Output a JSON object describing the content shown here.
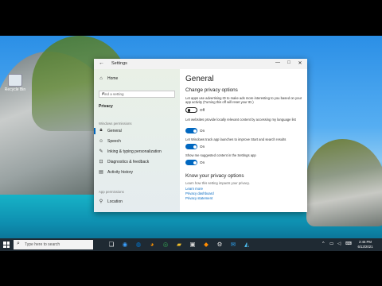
{
  "desktop": {
    "icon_label": "Recycle Bin"
  },
  "window": {
    "title": "Settings",
    "back_glyph": "←",
    "controls": {
      "minimize": "—",
      "maximize": "□",
      "close": "✕"
    }
  },
  "nav": {
    "home": "Home",
    "search_placeholder": "Find a setting",
    "privacy_header": "Privacy",
    "windows_permissions": "Windows permissions",
    "items": [
      {
        "label": "General",
        "icon": "lock-icon"
      },
      {
        "label": "Speech",
        "icon": "speech-icon"
      },
      {
        "label": "Inking & typing personalization",
        "icon": "inking-icon"
      },
      {
        "label": "Diagnostics & feedback",
        "icon": "diagnostics-icon"
      },
      {
        "label": "Activity history",
        "icon": "activity-icon"
      }
    ],
    "app_permissions": "App permissions",
    "location": "Location"
  },
  "content": {
    "title": "General",
    "section_title": "Change privacy options",
    "options": [
      {
        "desc": "Let apps use advertising ID to make ads more interesting to you based on your app activity (Turning this off will reset your ID.)",
        "state": "Off",
        "on": false
      },
      {
        "desc": "Let websites provide locally relevant content by accessing my language list",
        "state": "On",
        "on": true
      },
      {
        "desc": "Let Windows track app launches to improve Start and search results",
        "state": "On",
        "on": true
      },
      {
        "desc": "Show me suggested content in the Settings app",
        "state": "On",
        "on": true
      }
    ],
    "know_title": "Know your privacy options",
    "know_desc": "Learn how this setting impacts your privacy.",
    "links": [
      "Learn more",
      "Privacy dashboard",
      "Privacy statement"
    ]
  },
  "taskbar": {
    "search_placeholder": "Type here to search",
    "time": "2:45 PM",
    "date": "6/13/2021"
  },
  "colors": {
    "accent": "#0067c0",
    "taskbar": "#1f2a33"
  }
}
